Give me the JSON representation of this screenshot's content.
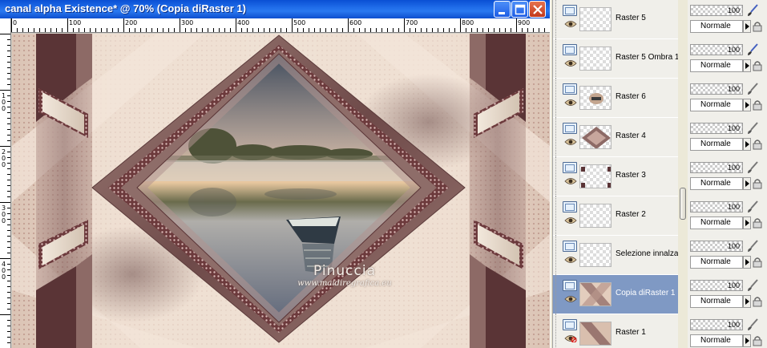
{
  "window": {
    "title": "canal alpha Existence* @  70% (Copia diRaster 1)"
  },
  "ruler": {
    "top_labels": [
      "0",
      "100",
      "200",
      "300",
      "400",
      "500",
      "600",
      "700",
      "800",
      "900"
    ],
    "left_labels": [
      "1 0 0",
      "2 0 0",
      "3 0 0",
      "4 0 0"
    ]
  },
  "watermark": {
    "name": "Pinuccia",
    "url": "www.maidiregrafica.eu"
  },
  "layers": [
    {
      "name": "Raster 5",
      "opacity": "100",
      "blend": "Normale",
      "selected": false
    },
    {
      "name": "Raster 5 Ombra 1",
      "opacity": "100",
      "blend": "Normale",
      "selected": false
    },
    {
      "name": "Raster 6",
      "opacity": "100",
      "blend": "Normale",
      "selected": false
    },
    {
      "name": "Raster 4",
      "opacity": "100",
      "blend": "Normale",
      "selected": false
    },
    {
      "name": "Raster 3",
      "opacity": "100",
      "blend": "Normale",
      "selected": false
    },
    {
      "name": "Raster 2",
      "opacity": "100",
      "blend": "Normale",
      "selected": false
    },
    {
      "name": "Selezione innalzata",
      "opacity": "100",
      "blend": "Normale",
      "selected": false
    },
    {
      "name": "Copia diRaster 1",
      "opacity": "100",
      "blend": "Normale",
      "selected": true
    },
    {
      "name": "Raster 1",
      "opacity": "100",
      "blend": "Normale",
      "selected": false
    }
  ],
  "colors": {
    "titlebar": "#0a4fd4",
    "selection": "#7f99c4",
    "mauve_dark": "#5a3436",
    "mauve_mid": "#8d6a66",
    "beige": "#e6d3c3"
  },
  "icons": {
    "minimize": "minimize-icon",
    "maximize": "maximize-icon",
    "close": "close-icon",
    "visibility": "eye-icon",
    "brush": "brush-icon",
    "lock": "lock-icon"
  }
}
